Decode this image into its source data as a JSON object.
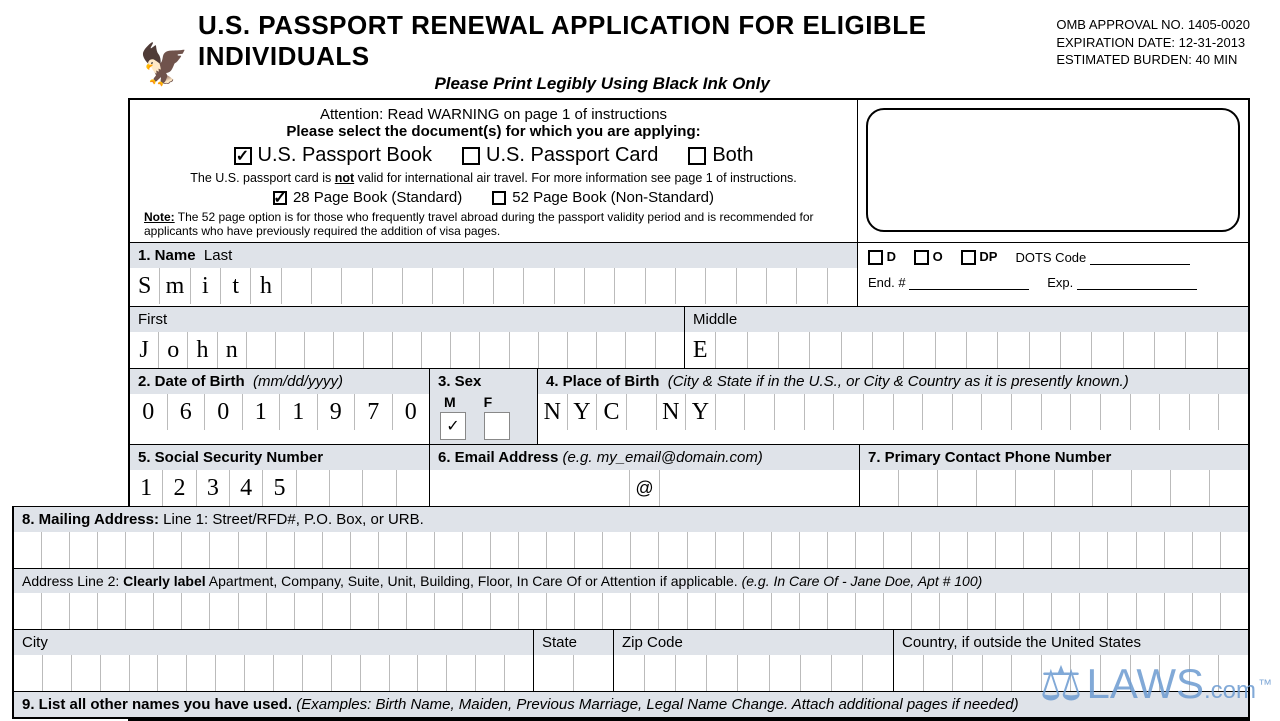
{
  "header": {
    "title": "U.S. PASSPORT RENEWAL APPLICATION FOR ELIGIBLE INDIVIDUALS",
    "subtitle": "Please Print Legibly Using Black Ink Only",
    "omb_approval": "OMB APPROVAL NO. 1405-0020",
    "omb_expiration": "EXPIRATION DATE: 12-31-2013",
    "omb_burden": "ESTIMATED BURDEN: 40 MIN"
  },
  "selection": {
    "attention": "Attention: Read WARNING on page 1 of instructions",
    "please_select": "Please select the document(s) for which you are applying:",
    "passport_book": "U.S. Passport Book",
    "passport_card": "U.S. Passport Card",
    "both": "Both",
    "book_checked": "✓",
    "card_checked": "",
    "both_checked": "",
    "card_note_pre": "The U.S. passport card is ",
    "card_note_bold": "not",
    "card_note_post": " valid for international air travel. For more information see page 1 of instructions.",
    "p28": "28 Page Book (Standard)",
    "p52": "52 Page Book (Non-Standard)",
    "p28_checked": "✓",
    "p52_checked": "",
    "note_label": "Note:",
    "note_text": " The 52 page option is for those who frequently travel abroad during the passport validity period and is recommended for applicants who have previously required the addition of visa pages."
  },
  "official": {
    "d": "D",
    "o": "O",
    "dp": "DP",
    "dots": "DOTS Code",
    "end": "End. #",
    "exp": "Exp."
  },
  "fields": {
    "name_last_label": "1.  Name",
    "last": "Last",
    "last_value": [
      "S",
      "m",
      "i",
      "t",
      "h",
      "",
      "",
      "",
      "",
      "",
      "",
      "",
      "",
      "",
      "",
      "",
      "",
      "",
      "",
      "",
      "",
      "",
      "",
      ""
    ],
    "first_label": "First",
    "first_value": [
      "J",
      "o",
      "h",
      "n",
      "",
      "",
      "",
      "",
      "",
      "",
      "",
      "",
      "",
      "",
      "",
      "",
      "",
      "",
      ""
    ],
    "middle_label": "Middle",
    "middle_value": [
      "E",
      "",
      "",
      "",
      "",
      "",
      "",
      "",
      "",
      "",
      "",
      "",
      "",
      "",
      "",
      "",
      "",
      ""
    ],
    "dob_label": "2.  Date of Birth",
    "dob_hint": "(mm/dd/yyyy)",
    "dob_value": [
      "0",
      "6",
      "0",
      "1",
      "1",
      "9",
      "7",
      "0"
    ],
    "sex_label": "3.  Sex",
    "sex_m": "M",
    "sex_f": "F",
    "sex_m_val": "✓",
    "sex_f_val": "",
    "pob_label": "4.  Place of Birth",
    "pob_hint": "(City & State if in the U.S., or City & Country as it is presently known.)",
    "pob_value": [
      "N",
      "Y",
      "C",
      "",
      "N",
      "Y",
      "",
      "",
      "",
      "",
      "",
      "",
      "",
      "",
      "",
      "",
      "",
      "",
      "",
      "",
      "",
      "",
      "",
      ""
    ],
    "ssn_label": "5.  Social Security Number",
    "ssn_value": [
      "1",
      "2",
      "3",
      "4",
      "5",
      "",
      "",
      "",
      ""
    ],
    "email_label": "6. Email Address",
    "email_hint": "(e.g. my_email@domain.com)",
    "email_at": "@",
    "phone_label": "7. Primary Contact Phone Number",
    "mailing_label": "8. Mailing Address:",
    "mailing_hint": " Line 1: Street/RFD#, P.O. Box, or URB.",
    "addr2_pre": "Address Line 2: ",
    "addr2_bold": "Clearly label",
    "addr2_post": " Apartment, Company, Suite, Unit, Building, Floor, In Care Of or Attention if applicable. ",
    "addr2_hint": "(e.g. In Care Of - Jane Doe, Apt # 100)",
    "city": "City",
    "state": "State",
    "zip": "Zip Code",
    "country": "Country, if outside the United States",
    "q9_label": "9. List all other names you have used.",
    "q9_hint": "(Examples: Birth Name, Maiden, Previous Marriage, Legal Name Change. Attach additional pages if needed)"
  },
  "watermark": {
    "text": "LAWS",
    "suffix": ".com",
    "tm": "™"
  }
}
